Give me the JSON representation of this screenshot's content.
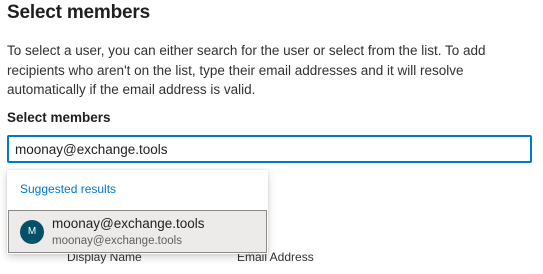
{
  "page": {
    "title": "Select members",
    "description": "To select a user, you can either search for the user or select from the list. To add recipients who aren't on the list, type their email addresses and it will resolve automatically if the email address is valid."
  },
  "members_field": {
    "label": "Select members",
    "value": "moonay@exchange.tools"
  },
  "suggestions": {
    "header": "Suggested results",
    "items": [
      {
        "initials": "M",
        "avatar_color": "#035168",
        "primary": "moonay@exchange.tools",
        "secondary": "moonay@exchange.tools"
      }
    ]
  },
  "table": {
    "columns": [
      "Display Name",
      "Email Address"
    ]
  },
  "colors": {
    "accent": "#0078d4",
    "hover_bg": "#edebe9"
  }
}
